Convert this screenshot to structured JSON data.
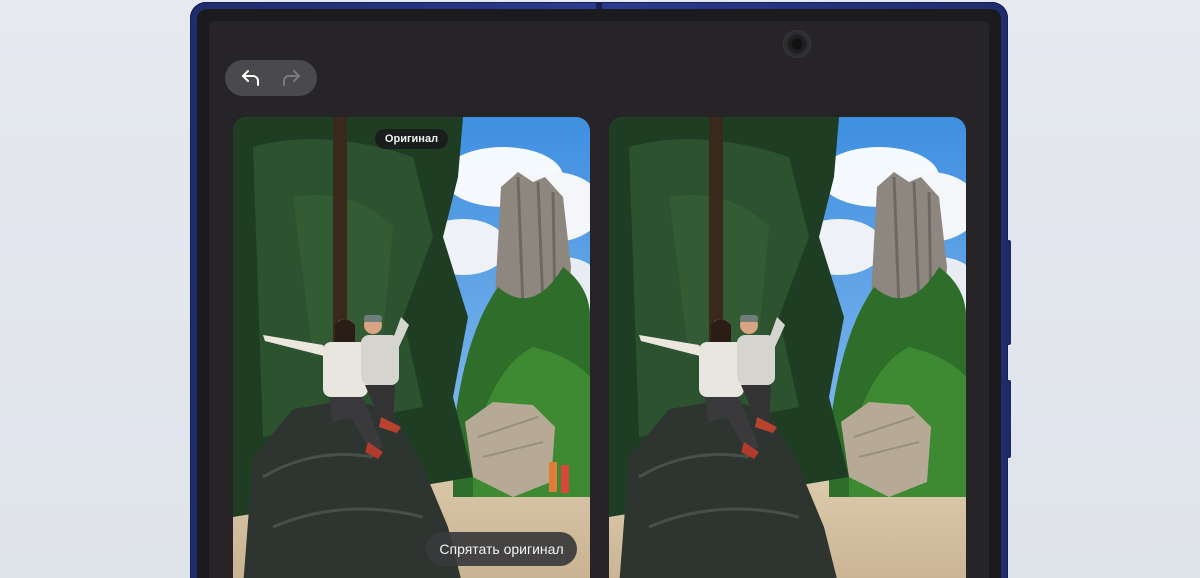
{
  "toolbar": {
    "undo_icon": "undo-arrow-icon",
    "redo_icon": "redo-arrow-icon",
    "redo_enabled": false
  },
  "comparison": {
    "original_badge": "Оригинал",
    "hide_original_button": "Спрятать оригинал"
  },
  "colors": {
    "phone_frame": "#2a3b8f",
    "screen_bg": "#262426",
    "pill_bg": "#4a494c",
    "page_bg": "#e3e7ee"
  }
}
